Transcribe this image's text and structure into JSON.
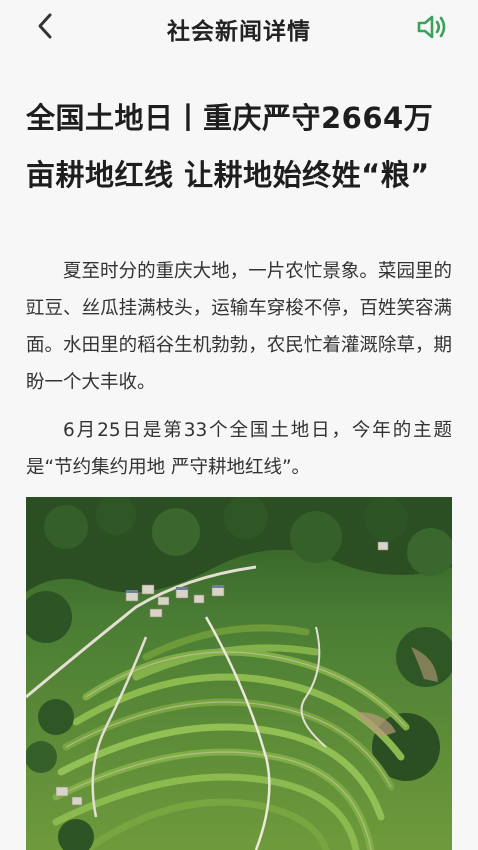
{
  "header": {
    "title": "社会新闻详情",
    "back_icon": "chevron-left-icon",
    "speaker_icon": "speaker-icon",
    "accent_color": "#3aa05a"
  },
  "article": {
    "headline": "全国土地日丨重庆严守2664万亩耕地红线 让耕地始终姓“粮”",
    "paragraphs": [
      "夏至时分的重庆大地，一片农忙景象。菜园里的豇豆、丝瓜挂满枝头，运输车穿梭不停，百姓笑容满面。水田里的稻谷生机勃勃，农民忙着灌溉除草，期盼一个大丰收。",
      "6月25日是第33个全国土地日，今年的主题是“节约集约用地 严守耕地红线”。"
    ]
  }
}
